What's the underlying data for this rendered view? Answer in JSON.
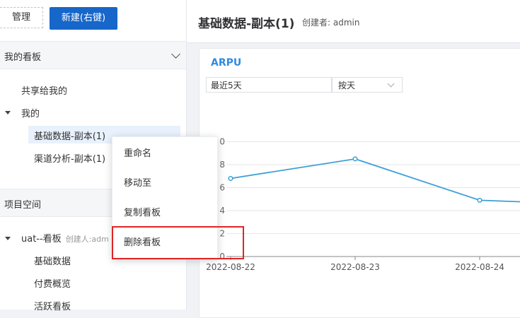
{
  "sidebar": {
    "manage_label": "管理",
    "new_label": "新建(右键)",
    "my_boards": {
      "title": "我的看板",
      "items": [
        "共享给我的",
        "我的",
        "基础数据-副本(1)",
        "渠道分析-副本(1)"
      ]
    },
    "project_space": {
      "title": "项目空间",
      "group_name": "uat--看板",
      "group_creator": "创建人:adm",
      "items": [
        "基础数据",
        "付费概览",
        "活跃看板"
      ]
    }
  },
  "header": {
    "title": "基础数据-副本(1)",
    "creator": "创建者: admin"
  },
  "card": {
    "title": "ARPU",
    "range_select": "最近5天",
    "granularity_select": "按天"
  },
  "context_menu": {
    "items": [
      "重命名",
      "移动至",
      "复制看板",
      "删除看板"
    ]
  },
  "chart_data": {
    "type": "line",
    "x": [
      "2022-08-22",
      "2022-08-23",
      "2022-08-24"
    ],
    "y_tick_labels": [
      "0",
      "2",
      "4",
      "6",
      "8",
      "0"
    ],
    "series": [
      {
        "values": [
          6.8,
          8.5,
          4.9,
          4.5
        ]
      }
    ],
    "line_color": "#3ea0d6"
  }
}
